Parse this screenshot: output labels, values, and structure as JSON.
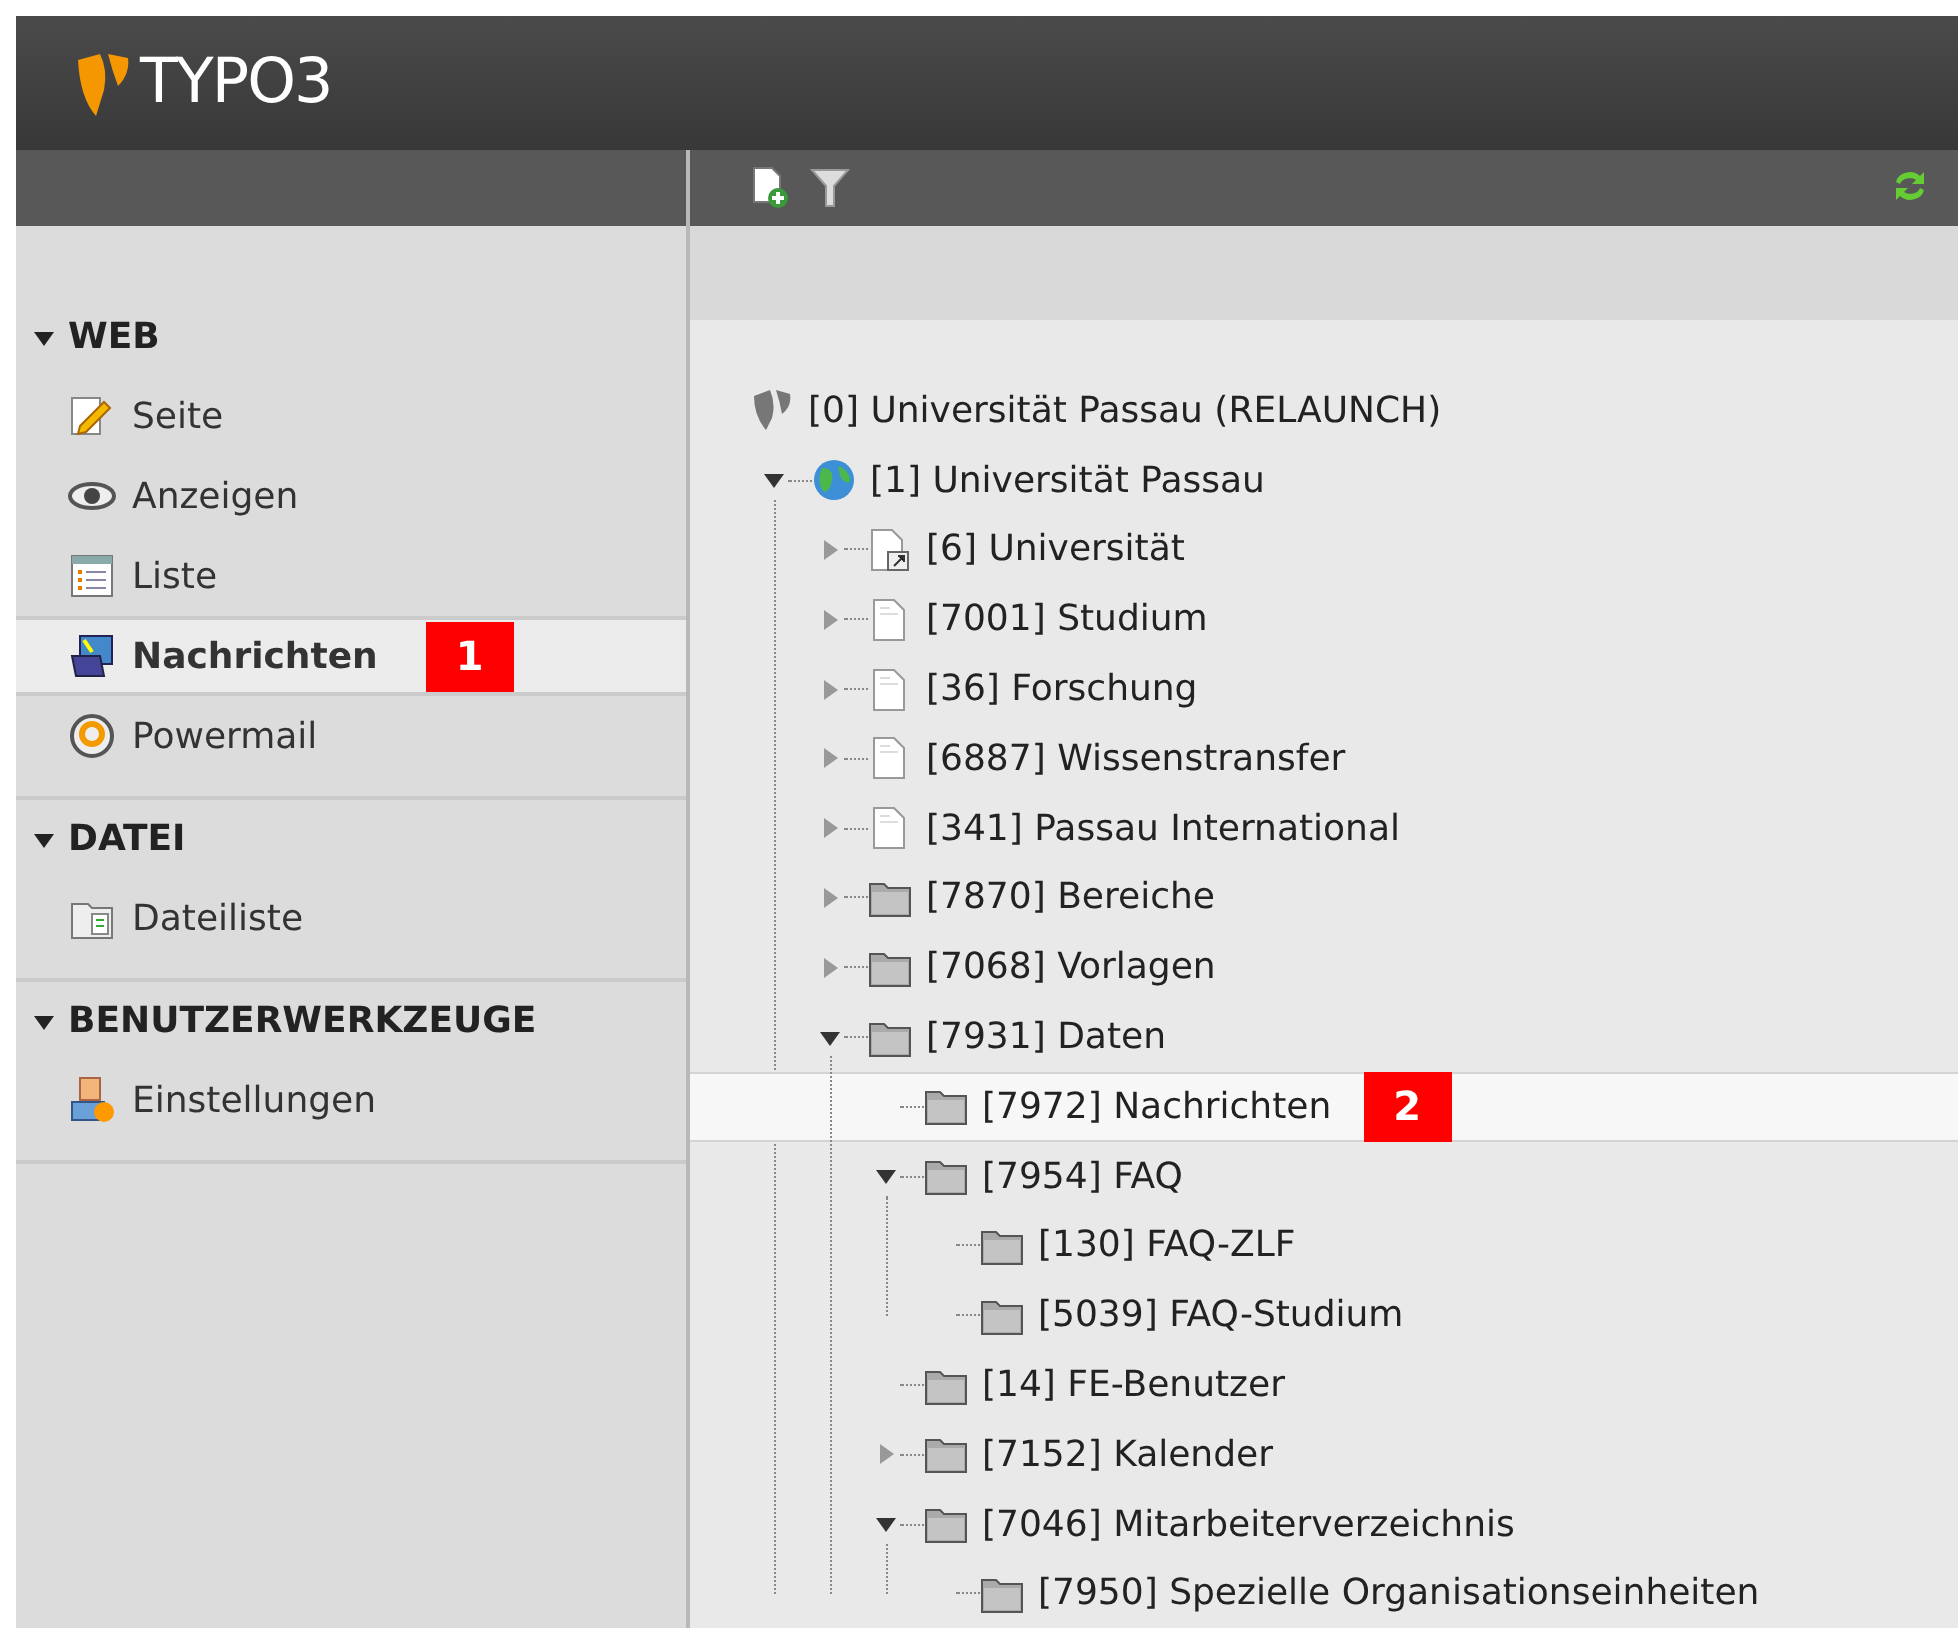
{
  "header": {
    "logo_text": "TYPO3"
  },
  "toolbar": {
    "buttons": [
      {
        "kind": "new-page"
      },
      {
        "kind": "filter"
      },
      {
        "kind": "refresh"
      }
    ]
  },
  "sidebar": {
    "sections": [
      {
        "title": "WEB",
        "expanded": true,
        "items": [
          {
            "label": "Seite",
            "kind": "page-edit",
            "selected": false
          },
          {
            "label": "Anzeigen",
            "kind": "view",
            "selected": false
          },
          {
            "label": "Liste",
            "kind": "list",
            "selected": false
          },
          {
            "label": "Nachrichten",
            "kind": "news",
            "selected": true,
            "callout": "1"
          },
          {
            "label": "Powermail",
            "kind": "powermail",
            "selected": false
          }
        ]
      },
      {
        "title": "DATEI",
        "expanded": true,
        "items": [
          {
            "label": "Dateiliste",
            "kind": "filelist",
            "selected": false
          }
        ]
      },
      {
        "title": "BENUTZERWERKZEUGE",
        "expanded": true,
        "items": [
          {
            "label": "Einstellungen",
            "kind": "user",
            "selected": false
          }
        ]
      }
    ]
  },
  "page_tree": {
    "nodes": [
      {
        "label": "[0] Universität Passau (RELAUNCH)",
        "kind": "root",
        "selected": false,
        "children": [
          {
            "label": "[1] Universität Passau",
            "kind": "globe",
            "expanded": true,
            "selected": false,
            "children": [
              {
                "label": "[6] Universität",
                "kind": "shortcut",
                "expanded": false,
                "selected": false
              },
              {
                "label": "[7001] Studium",
                "kind": "page",
                "expanded": false,
                "selected": false
              },
              {
                "label": "[36] Forschung",
                "kind": "page",
                "expanded": false,
                "selected": false
              },
              {
                "label": "[6887] Wissenstransfer",
                "kind": "page",
                "expanded": false,
                "selected": false
              },
              {
                "label": "[341] Passau International",
                "kind": "page",
                "expanded": false,
                "selected": false
              },
              {
                "label": "[7870] Bereiche",
                "kind": "folder",
                "expanded": false,
                "selected": false
              },
              {
                "label": "[7068] Vorlagen",
                "kind": "folder",
                "expanded": false,
                "selected": false
              },
              {
                "label": "[7931] Daten",
                "kind": "folder",
                "expanded": true,
                "selected": false,
                "children": [
                  {
                    "label": "[7972] Nachrichten",
                    "kind": "folder",
                    "selected": true,
                    "callout": "2"
                  },
                  {
                    "label": "[7954] FAQ",
                    "kind": "folder",
                    "expanded": true,
                    "selected": false,
                    "children": [
                      {
                        "label": "[130] FAQ-ZLF",
                        "kind": "folder",
                        "selected": false
                      },
                      {
                        "label": "[5039] FAQ-Studium",
                        "kind": "folder",
                        "selected": false
                      }
                    ]
                  },
                  {
                    "label": "[14] FE-Benutzer",
                    "kind": "folder",
                    "selected": false
                  },
                  {
                    "label": "[7152] Kalender",
                    "kind": "folder",
                    "expanded": false,
                    "selected": false
                  },
                  {
                    "label": "[7046] Mitarbeiterverzeichnis",
                    "kind": "folder",
                    "expanded": true,
                    "selected": false,
                    "children": [
                      {
                        "label": "[7950] Spezielle Organisationseinheiten",
                        "kind": "folder",
                        "selected": false
                      }
                    ]
                  }
                ]
              }
            ]
          }
        ]
      }
    ]
  }
}
